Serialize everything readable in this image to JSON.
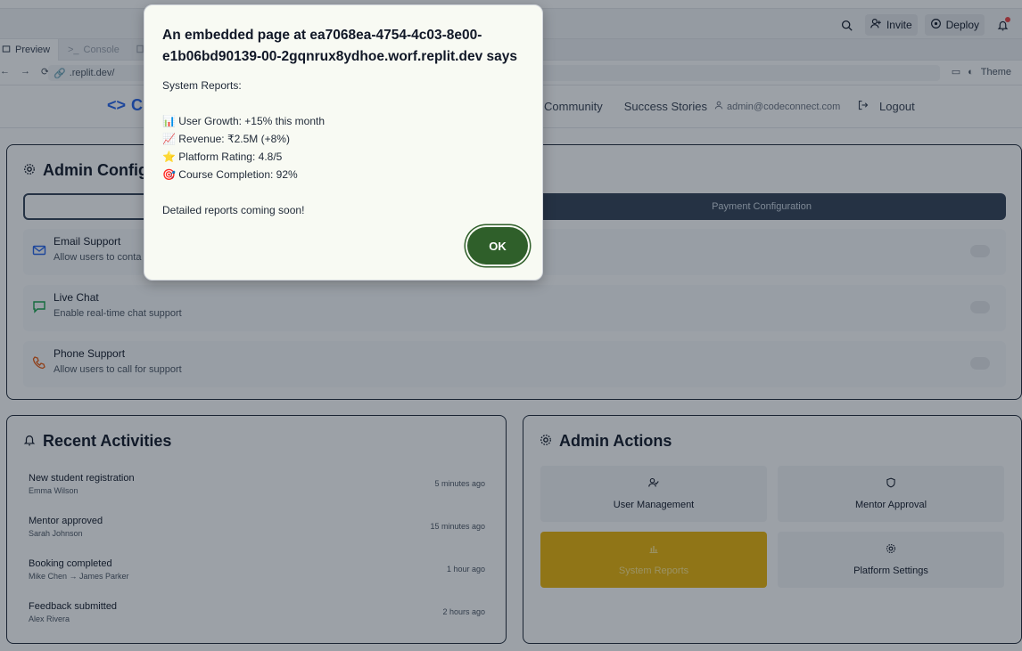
{
  "workspace": {
    "invite_label": "Invite",
    "deploy_label": "Deploy",
    "tabs": {
      "preview": "Preview",
      "console": "Console"
    },
    "url": ".replit.dev/",
    "theme_label": "Theme"
  },
  "app": {
    "logo_text": "C",
    "nav": {
      "community": "Community",
      "success_stories": "Success Stories",
      "email": "admin@codeconnect.com",
      "logout": "Logout"
    },
    "admin_config": {
      "title": "Admin Configu",
      "tab_payment": "Payment Configuration",
      "options": [
        {
          "title": "Email Support",
          "desc": "Allow users to conta",
          "icon": "mail-icon"
        },
        {
          "title": "Live Chat",
          "desc": "Enable real-time chat support",
          "icon": "chat-icon"
        },
        {
          "title": "Phone Support",
          "desc": "Allow users to call for support",
          "icon": "phone-icon"
        }
      ]
    },
    "recent_activities": {
      "title": "Recent Activities",
      "items": [
        {
          "title": "New student registration",
          "sub": "Emma Wilson",
          "time": "5 minutes ago"
        },
        {
          "title": "Mentor approved",
          "sub": "Sarah Johnson",
          "time": "15 minutes ago"
        },
        {
          "title": "Booking completed",
          "sub": "Mike Chen → James Parker",
          "time": "1 hour ago"
        },
        {
          "title": "Feedback submitted",
          "sub": "Alex Rivera",
          "time": "2 hours ago"
        }
      ]
    },
    "admin_actions": {
      "title": "Admin Actions",
      "tiles": [
        {
          "label": "User Management",
          "icon": "user-check-icon"
        },
        {
          "label": "Mentor Approval",
          "icon": "shield-icon"
        },
        {
          "label": "System Reports",
          "icon": "bar-chart-icon"
        },
        {
          "label": "Platform Settings",
          "icon": "gear-icon"
        }
      ]
    }
  },
  "dialog": {
    "title": "An embedded page at ea7068ea-4754-4c03-8e00-e1b06bd90139-00-2gqnrux8ydhoe.worf.replit.dev says",
    "lines": [
      "System Reports:",
      "",
      "📊 User Growth: +15% this month",
      "📈 Revenue: ₹2.5M (+8%)",
      "⭐ Platform Rating: 4.8/5",
      "🎯 Course Completion: 92%",
      "",
      "Detailed reports coming soon!"
    ],
    "ok_label": "OK"
  },
  "colors": {
    "accent": "#2563eb",
    "ok_button": "#2f5f2a",
    "highlight_tile": "#eab308",
    "tab_dark": "#334155"
  }
}
